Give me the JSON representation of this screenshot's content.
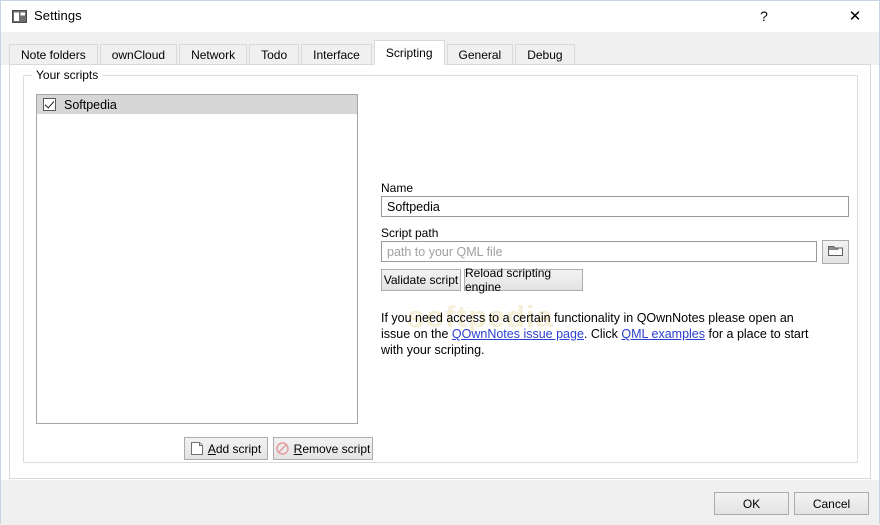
{
  "window": {
    "title": "Settings",
    "icon": "app-window-icon",
    "help_label": "?",
    "close_label": "✕"
  },
  "tabs": [
    {
      "label": "Note folders",
      "active": false
    },
    {
      "label": "ownCloud",
      "active": false
    },
    {
      "label": "Network",
      "active": false
    },
    {
      "label": "Todo",
      "active": false
    },
    {
      "label": "Interface",
      "active": false
    },
    {
      "label": "Scripting",
      "active": true
    },
    {
      "label": "General",
      "active": false
    },
    {
      "label": "Debug",
      "active": false
    }
  ],
  "scripting": {
    "groupbox_title": "Your scripts",
    "scripts": [
      {
        "name": "Softpedia",
        "checked": true,
        "selected": true
      }
    ],
    "add_script_label_prefix": "A",
    "add_script_label_rest": "dd script",
    "remove_script_label_prefix": "R",
    "remove_script_label_rest": "emove script",
    "name_label": "Name",
    "name_value": "Softpedia",
    "script_path_label": "Script path",
    "script_path_value": "",
    "script_path_placeholder": "path to your QML file",
    "browse_icon": "folder-icon",
    "validate_button": "Validate script",
    "reload_button": "Reload scripting engine",
    "info_part1": "If you need access to a certain functionality in QOwnNotes please open an issue on the ",
    "info_link1": "QOwnNotes issue page",
    "info_part2": ". Click ",
    "info_link2": "QML examples",
    "info_part3": " for a place to start with your scripting.",
    "watermark": "softpedia"
  },
  "footer": {
    "ok_label": "OK",
    "cancel_label": "Cancel"
  },
  "colors": {
    "link": "#2a3fd0",
    "selection": "#d6d6d6",
    "remove_icon": "#e08a8a",
    "panel_bg": "#ffffff",
    "chrome_bg": "#f0f0f0"
  }
}
